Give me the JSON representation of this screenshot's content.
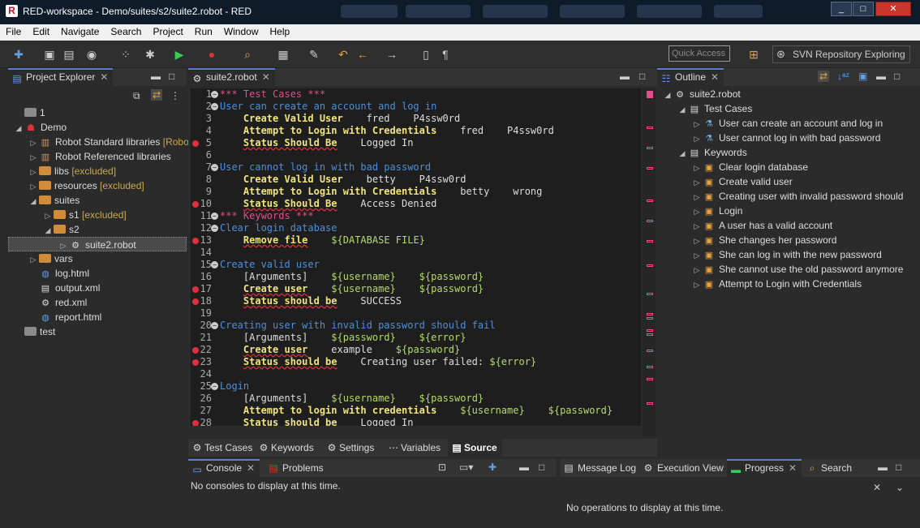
{
  "window": {
    "title": "RED-workspace - Demo/suites/s2/suite2.robot - RED"
  },
  "menu": [
    "File",
    "Edit",
    "Navigate",
    "Search",
    "Project",
    "Run",
    "Window",
    "Help"
  ],
  "toolbar": {
    "quick_access": "Quick Access",
    "svn_perspective": "SVN Repository Exploring"
  },
  "project_explorer": {
    "tab_label": "Project Explorer",
    "items": [
      {
        "label": "1",
        "extra": ""
      },
      {
        "label": "Demo",
        "extra": ""
      },
      {
        "label": "Robot Standard libraries",
        "extra": "[Robot"
      },
      {
        "label": "Robot Referenced libraries",
        "extra": ""
      },
      {
        "label": "libs",
        "extra": "[excluded]"
      },
      {
        "label": "resources",
        "extra": "[excluded]"
      },
      {
        "label": "suites",
        "extra": ""
      },
      {
        "label": "s1",
        "extra": "[excluded]"
      },
      {
        "label": "s2",
        "extra": ""
      },
      {
        "label": "suite2.robot",
        "extra": ""
      },
      {
        "label": "vars",
        "extra": ""
      },
      {
        "label": "log.html",
        "extra": ""
      },
      {
        "label": "output.xml",
        "extra": ""
      },
      {
        "label": "red.xml",
        "extra": ""
      },
      {
        "label": "report.html",
        "extra": ""
      },
      {
        "label": "test",
        "extra": ""
      }
    ]
  },
  "editor": {
    "tab_label": "suite2.robot",
    "lines": [
      {
        "n": "1",
        "parts": [
          {
            "t": "*** Test Cases ***",
            "c": "sec"
          }
        ]
      },
      {
        "n": "2",
        "parts": [
          {
            "t": "User can create an account and log in",
            "c": "tc"
          }
        ]
      },
      {
        "n": "3",
        "parts": [
          {
            "t": "    ",
            "c": "arg"
          },
          {
            "t": "Create Valid User",
            "c": "kw"
          },
          {
            "t": "    fred    P4ssw0rd",
            "c": "arg"
          }
        ]
      },
      {
        "n": "4",
        "parts": [
          {
            "t": "    ",
            "c": "arg"
          },
          {
            "t": "Attempt to Login with Credentials",
            "c": "kw"
          },
          {
            "t": "    fred    P4ssw0rd",
            "c": "arg"
          }
        ]
      },
      {
        "n": "5",
        "parts": [
          {
            "t": "    ",
            "c": "arg"
          },
          {
            "t": "Status Should Be",
            "c": "kw"
          },
          {
            "t": "    Logged In",
            "c": "arg"
          }
        ]
      },
      {
        "n": "6",
        "parts": []
      },
      {
        "n": "7",
        "parts": [
          {
            "t": "User cannot log in with bad password",
            "c": "tc"
          }
        ]
      },
      {
        "n": "8",
        "parts": [
          {
            "t": "    ",
            "c": "arg"
          },
          {
            "t": "Create Valid User",
            "c": "kw"
          },
          {
            "t": "    betty    P4ssw0rd",
            "c": "arg"
          }
        ]
      },
      {
        "n": "9",
        "parts": [
          {
            "t": "    ",
            "c": "arg"
          },
          {
            "t": "Attempt to Login with Credentials",
            "c": "kw"
          },
          {
            "t": "    betty    wrong",
            "c": "arg"
          }
        ]
      },
      {
        "n": "10",
        "parts": [
          {
            "t": "    ",
            "c": "arg"
          },
          {
            "t": "Status Should Be",
            "c": "kw"
          },
          {
            "t": "    Access Denied",
            "c": "arg"
          }
        ]
      },
      {
        "n": "11",
        "parts": [
          {
            "t": "*** Keywords ***",
            "c": "sec"
          }
        ]
      },
      {
        "n": "12",
        "parts": [
          {
            "t": "Clear login database",
            "c": "tc"
          }
        ]
      },
      {
        "n": "13",
        "parts": [
          {
            "t": "    ",
            "c": "arg"
          },
          {
            "t": "Remove file",
            "c": "kw"
          },
          {
            "t": "    ",
            "c": "arg"
          },
          {
            "t": "${DATABASE FILE}",
            "c": "var"
          }
        ]
      },
      {
        "n": "14",
        "parts": []
      },
      {
        "n": "15",
        "parts": [
          {
            "t": "Create valid user",
            "c": "tc"
          }
        ]
      },
      {
        "n": "16",
        "parts": [
          {
            "t": "    [Arguments]    ",
            "c": "set"
          },
          {
            "t": "${username}",
            "c": "var"
          },
          {
            "t": "    ",
            "c": "arg"
          },
          {
            "t": "${password}",
            "c": "var"
          }
        ]
      },
      {
        "n": "17",
        "parts": [
          {
            "t": "    ",
            "c": "arg"
          },
          {
            "t": "Create user",
            "c": "kw"
          },
          {
            "t": "    ",
            "c": "arg"
          },
          {
            "t": "${username}",
            "c": "var"
          },
          {
            "t": "    ",
            "c": "arg"
          },
          {
            "t": "${password}",
            "c": "var"
          }
        ]
      },
      {
        "n": "18",
        "parts": [
          {
            "t": "    ",
            "c": "arg"
          },
          {
            "t": "Status should be",
            "c": "kw"
          },
          {
            "t": "    SUCCESS",
            "c": "arg"
          }
        ]
      },
      {
        "n": "19",
        "parts": []
      },
      {
        "n": "20",
        "parts": [
          {
            "t": "Creating user with invalid password should fail",
            "c": "tc"
          }
        ]
      },
      {
        "n": "21",
        "parts": [
          {
            "t": "    [Arguments]    ",
            "c": "set"
          },
          {
            "t": "${password}",
            "c": "var"
          },
          {
            "t": "    ",
            "c": "arg"
          },
          {
            "t": "${error}",
            "c": "var"
          }
        ]
      },
      {
        "n": "22",
        "parts": [
          {
            "t": "    ",
            "c": "arg"
          },
          {
            "t": "Create user",
            "c": "kw"
          },
          {
            "t": "    example    ",
            "c": "arg"
          },
          {
            "t": "${password}",
            "c": "var"
          }
        ]
      },
      {
        "n": "23",
        "parts": [
          {
            "t": "    ",
            "c": "arg"
          },
          {
            "t": "Status should be",
            "c": "kw"
          },
          {
            "t": "    Creating user failed: ",
            "c": "arg"
          },
          {
            "t": "${error}",
            "c": "var"
          }
        ]
      },
      {
        "n": "24",
        "parts": []
      },
      {
        "n": "25",
        "parts": [
          {
            "t": "Login",
            "c": "tc"
          }
        ]
      },
      {
        "n": "26",
        "parts": [
          {
            "t": "    [Arguments]    ",
            "c": "set"
          },
          {
            "t": "${username}",
            "c": "var"
          },
          {
            "t": "    ",
            "c": "arg"
          },
          {
            "t": "${password}",
            "c": "var"
          }
        ]
      },
      {
        "n": "27",
        "parts": [
          {
            "t": "    ",
            "c": "arg"
          },
          {
            "t": "Attempt to login with credentials",
            "c": "kw"
          },
          {
            "t": "    ",
            "c": "arg"
          },
          {
            "t": "${username}",
            "c": "var"
          },
          {
            "t": "    ",
            "c": "arg"
          },
          {
            "t": "${password}",
            "c": "var"
          }
        ]
      },
      {
        "n": "28",
        "parts": [
          {
            "t": "    ",
            "c": "arg"
          },
          {
            "t": "Status should be",
            "c": "kw"
          },
          {
            "t": "    Logged In",
            "c": "arg"
          }
        ]
      }
    ],
    "bottom_tabs": [
      "Test Cases",
      "Keywords",
      "Settings",
      "Variables",
      "Source"
    ]
  },
  "outline": {
    "tab_label": "Outline",
    "root": "suite2.robot",
    "test_cases_label": "Test Cases",
    "test_cases": [
      "User can create an account and log in",
      "User cannot log in with bad password"
    ],
    "keywords_label": "Keywords",
    "keywords": [
      "Clear login database",
      "Create valid user",
      "Creating user with invalid password should",
      "Login",
      "A user has a valid account",
      "She changes her password",
      "She can log in with the new password",
      "She cannot use the old password anymore",
      "Attempt to Login with Credentials"
    ]
  },
  "console": {
    "tab_label": "Console",
    "problems_label": "Problems",
    "message": "No consoles to display at this time."
  },
  "progress_panel": {
    "tabs": [
      "Message Log",
      "Execution View",
      "Progress",
      "Search"
    ],
    "message": "No operations to display at this time."
  }
}
